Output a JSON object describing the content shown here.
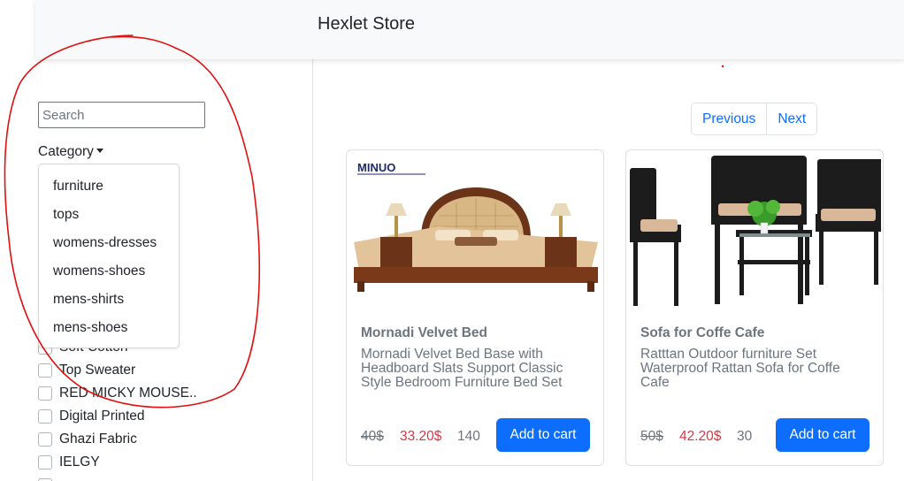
{
  "navbar": {
    "brand": "Hexlet Store"
  },
  "sidebar": {
    "search_placeholder": "Search",
    "category_label": "Category",
    "dropdown_items": [
      "furniture",
      "tops",
      "womens-dresses",
      "womens-shoes",
      "mens-shirts",
      "mens-shoes"
    ],
    "brand_checkboxes": [
      "Soft Cotton",
      "Top Sweater",
      "RED MICKY MOUSE..",
      "Digital Printed",
      "Ghazi Fabric",
      "IELGY"
    ]
  },
  "pagination": {
    "previous": "Previous",
    "next": "Next"
  },
  "products": [
    {
      "title": "Mornadi Velvet Bed",
      "description": "Mornadi Velvet Bed Base with Headboard Slats Support Classic Style Bedroom Furniture Bed Set",
      "old_price": "40$",
      "price": "33.20$",
      "stock": "140",
      "button": "Add to cart",
      "image_icon": "bed-product-image",
      "logo_text": "MINUO"
    },
    {
      "title": "Sofa for Coffe Cafe",
      "description": "Ratttan Outdoor furniture Set Waterproof Rattan Sofa for Coffe Cafe",
      "old_price": "50$",
      "price": "42.20$",
      "stock": "30",
      "button": "Add to cart",
      "image_icon": "rattan-furniture-image"
    }
  ],
  "colors": {
    "primary": "#0d6efd",
    "sale_price": "#dc3545",
    "annotation": "#e01010"
  }
}
